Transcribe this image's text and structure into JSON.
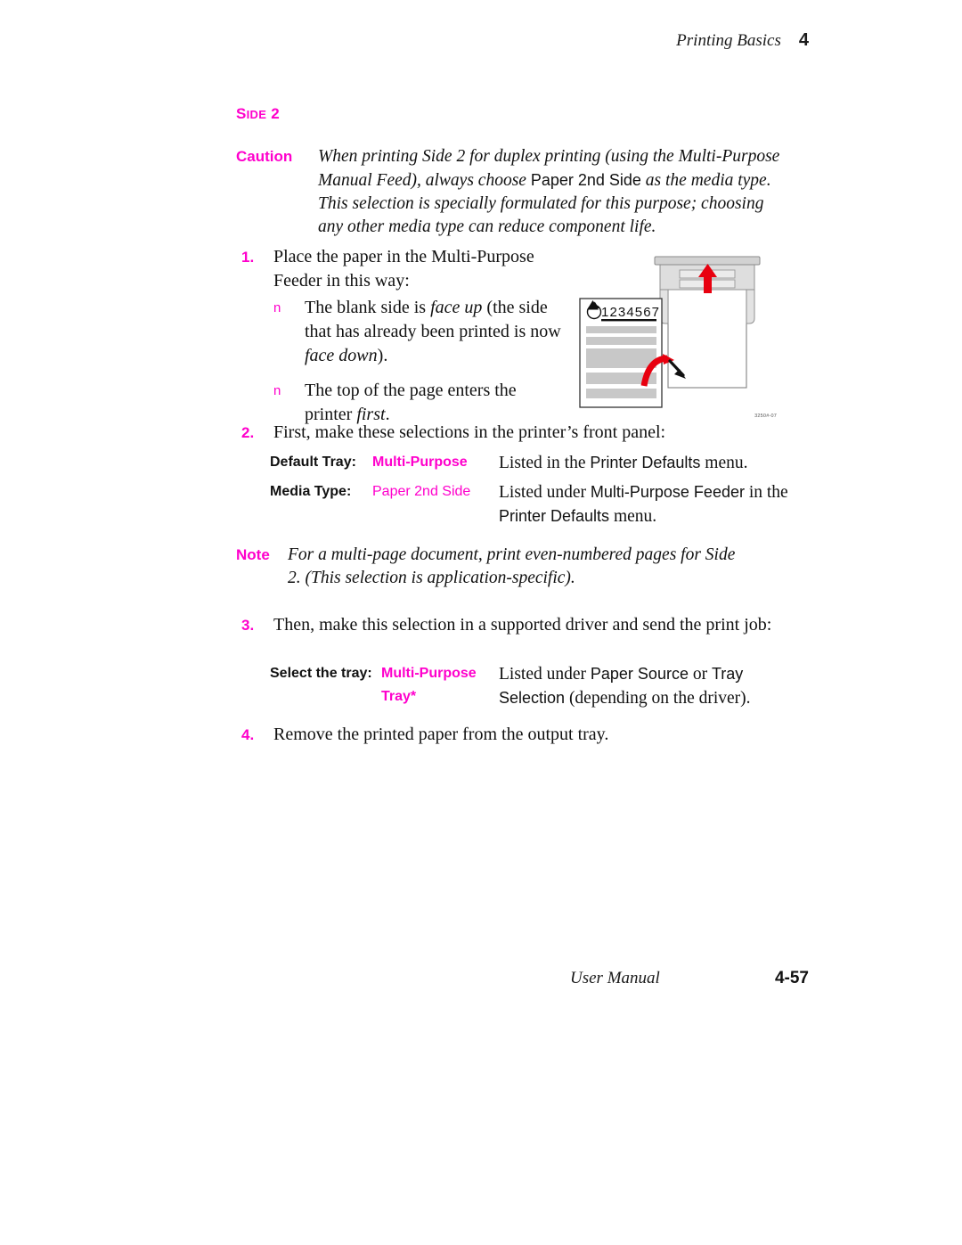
{
  "header": {
    "title": "Printing Basics",
    "chapter_number": "4"
  },
  "section": {
    "label_first": "S",
    "label_rest": "IDE",
    "label_number": " 2"
  },
  "caution": {
    "keyword": "Caution",
    "text_part1": "When printing Side 2 for duplex printing (using the Multi-Purpose Manual Feed), always choose ",
    "ui_term": "Paper 2nd Side",
    "text_part2": " as the media type. This selection is specially formulated for this purpose; choosing any other media type can reduce component life."
  },
  "steps": [
    {
      "number": "1.",
      "text": "Place the paper in the Multi-Purpose Feeder in this way:"
    },
    {
      "number": "2.",
      "text": "First, make these selections in the printer’s front panel:"
    },
    {
      "number": "3.",
      "text": "Then, make this selection in a supported driver and send the print job:"
    },
    {
      "number": "4.",
      "text": "Remove the printed paper from the output tray."
    }
  ],
  "bullets": [
    {
      "marker": "n",
      "part1": "The blank side is ",
      "em1": "face up",
      "part2": " (the side that has already been printed is now ",
      "em2": "face down",
      "part3": ")."
    },
    {
      "marker": "n",
      "part1": "The top of the page enters the printer ",
      "em1": "first",
      "part2": ".",
      "em2": "",
      "part3": ""
    }
  ],
  "settings_front_panel": [
    {
      "label": "Default Tray:",
      "value": "Multi-Purpose",
      "desc_pre": "Listed in the ",
      "desc_ui": "Printer Defaults",
      "desc_post": " menu."
    },
    {
      "label": "Media Type:",
      "value": "Paper 2nd Side",
      "desc_pre": "Listed under ",
      "desc_ui": "Multi-Purpose Feeder",
      "desc_mid": " in the ",
      "desc_ui2": "Printer Defaults",
      "desc_post": " menu."
    }
  ],
  "settings_driver": {
    "label": "Select the tray:",
    "value_line1": "Multi-Purpose",
    "value_line2": "Tray*",
    "desc_pre": "Listed under ",
    "desc_ui": "Paper Source",
    "desc_mid": " or ",
    "desc_ui2": "Tray Selection",
    "desc_post": " (depending on the driver)."
  },
  "note": {
    "keyword": "Note",
    "text": "For a multi-page document, print even-numbered pages for Side 2.  (This selection is application-specific)."
  },
  "figure": {
    "page_digits": "1234567",
    "caption_id": "3250#-07",
    "colors": {
      "red_arrow": "#e8000f",
      "gray_bar": "#c8c8c8",
      "gray_body": "#d9d9d9",
      "outline": "#808080"
    }
  },
  "footer": {
    "title": "User Manual",
    "page_number": "4-57"
  },
  "theme": {
    "magenta": "#ff00cc",
    "text_black": "#111111"
  }
}
